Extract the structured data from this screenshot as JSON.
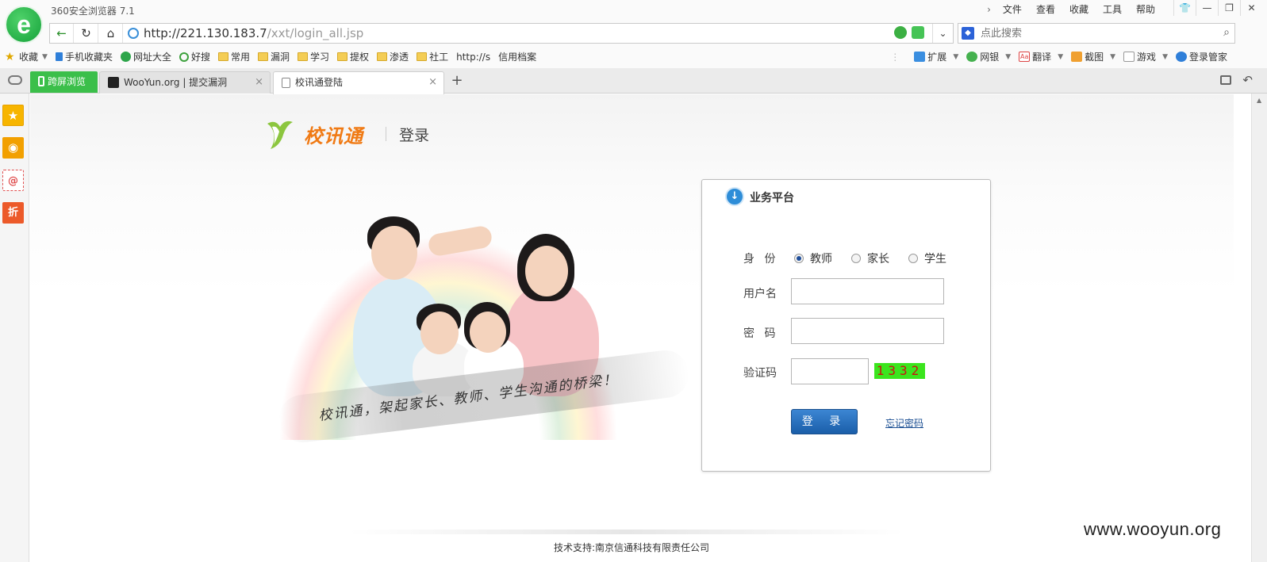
{
  "browser": {
    "window_title": "360安全浏览器 7.1",
    "menu": [
      "文件",
      "查看",
      "收藏",
      "工具",
      "帮助"
    ],
    "url_host": "http://221.130.183.7",
    "url_path": "/xxt/login_all.jsp",
    "search_placeholder": "点此搜索",
    "favorites": [
      {
        "label": "收藏",
        "icon": "star-icon"
      },
      {
        "label": "手机收藏夹",
        "icon": "phone-icon"
      },
      {
        "label": "网址大全",
        "icon": "plus-icon"
      },
      {
        "label": "好搜",
        "icon": "search-circle-icon"
      },
      {
        "label": "常用",
        "icon": "folder-icon"
      },
      {
        "label": "漏洞",
        "icon": "folder-icon"
      },
      {
        "label": "学习",
        "icon": "folder-icon"
      },
      {
        "label": "提权",
        "icon": "folder-icon"
      },
      {
        "label": "渗透",
        "icon": "folder-icon"
      },
      {
        "label": "社工",
        "icon": "folder-icon"
      },
      {
        "label": "http://s",
        "icon": "page-icon"
      },
      {
        "label": "信用档案",
        "icon": "page-icon"
      }
    ],
    "tools": [
      {
        "label": "扩展",
        "icon": "extension-icon"
      },
      {
        "label": "网银",
        "icon": "bank-icon"
      },
      {
        "label": "翻译",
        "icon": "translate-icon"
      },
      {
        "label": "截图",
        "icon": "screenshot-icon"
      },
      {
        "label": "游戏",
        "icon": "game-icon"
      },
      {
        "label": "登录管家",
        "icon": "login-manager-icon"
      }
    ],
    "tabs": [
      {
        "label": "跨屏浏览"
      },
      {
        "label": "WooYun.org | 提交漏洞"
      },
      {
        "label": "校讯通登陆"
      }
    ]
  },
  "page": {
    "brand_name": "校讯通",
    "brand_title": "登录",
    "slogan": "校讯通，架起家长、教师、学生沟通的桥梁！",
    "panel_title": "业务平台",
    "identity_label": "身  份",
    "identity_options": [
      "教师",
      "家长",
      "学生"
    ],
    "identity_selected": "教师",
    "username_label": "用户名",
    "username_value": "",
    "password_label": "密  码",
    "password_value": "",
    "captcha_label": "验证码",
    "captcha_value": "",
    "captcha_code": "1332",
    "login_button": "登 录",
    "forgot_link": "忘记密码",
    "footer": "技术支持:南京信通科技有限责任公司",
    "watermark": "www.wooyun.org"
  },
  "colors": {
    "brand_orange": "#f07a14",
    "button_blue": "#1a5ea9",
    "captcha_bg": "#3be51e",
    "captcha_text": "#cc1111",
    "browser_green": "#3bbf4a"
  }
}
